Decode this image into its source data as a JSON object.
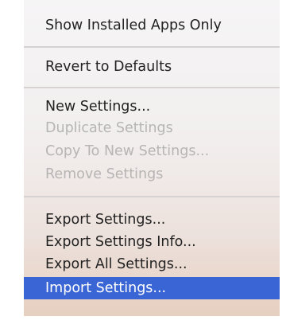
{
  "menu": {
    "items": [
      {
        "label": "Show Installed Apps Only"
      },
      {
        "label": "Revert to Defaults"
      },
      {
        "label": "New Settings..."
      },
      {
        "label": "Duplicate Settings"
      },
      {
        "label": "Copy To New Settings..."
      },
      {
        "label": "Remove Settings"
      },
      {
        "label": "Export Settings..."
      },
      {
        "label": "Export Settings Info..."
      },
      {
        "label": "Export All Settings..."
      },
      {
        "label": "Import Settings..."
      }
    ]
  },
  "colors": {
    "selected_background": "#3a65d4",
    "disabled_text": "#b7b4b4",
    "text": "#222222"
  }
}
